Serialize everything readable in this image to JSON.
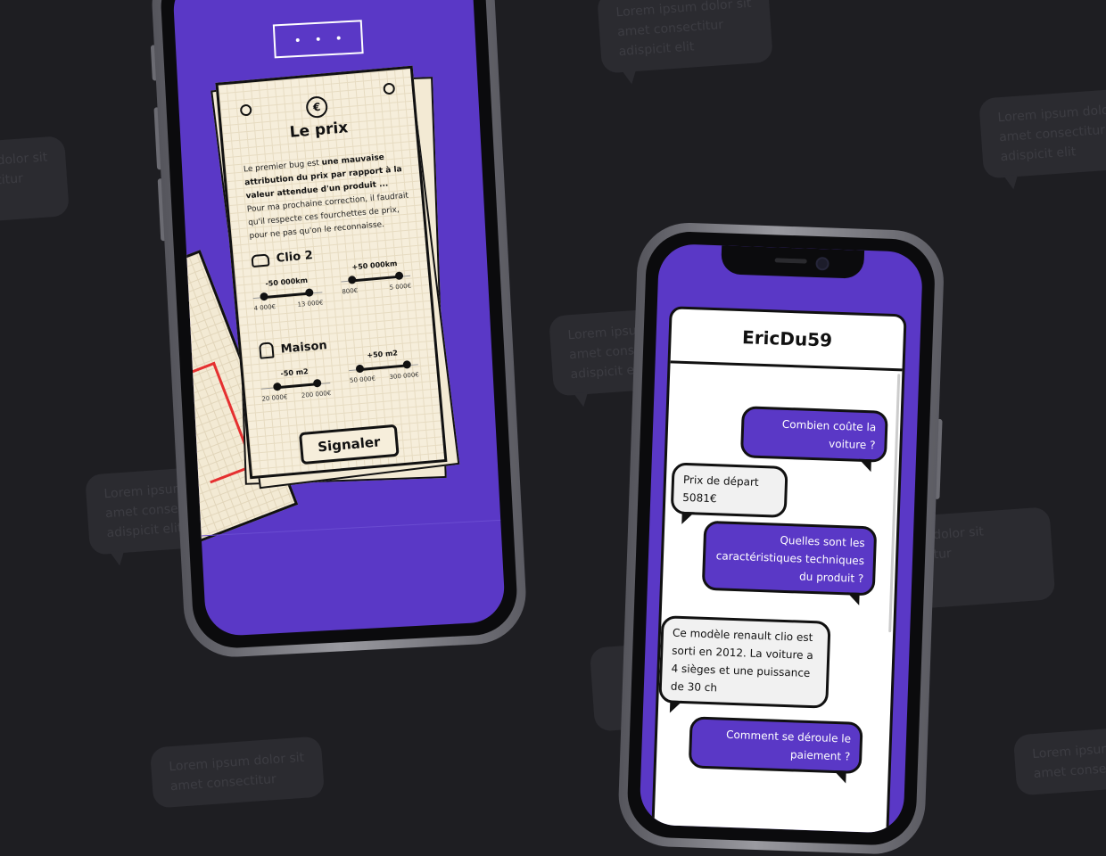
{
  "background_bubbles": [
    {
      "lines": [
        "Lorem ipsum dolor sit",
        "amet consectitur",
        "adispicit elit"
      ]
    },
    {
      "lines": [
        "Lorem ipsum dolor sit",
        "amet consectitur",
        "adispicit elit"
      ]
    },
    {
      "lines": [
        "m dolor sit",
        "ectitur",
        "it"
      ]
    },
    {
      "lines": [
        "Lorem ipsum",
        "amet consect",
        "adispicit elit"
      ]
    },
    {
      "lines": [
        "Lorem ipsum",
        "amet consect",
        "adispicit elit"
      ]
    },
    {
      "lines": [
        "m dolor sit",
        "ctitur"
      ]
    },
    {
      "lines": [
        "Lorem ipsum dolor sit",
        "amet consectitur"
      ]
    },
    {
      "lines": [
        "Lorem ipsum",
        "amet consec"
      ]
    }
  ],
  "phone1": {
    "card": {
      "title": "Le prix",
      "desc_part1": "Le premier bug est ",
      "desc_bold": "une mauvaise attribution du prix par rapport à la valeur attendue d'un produit ...",
      "desc_part2": " Pour ma prochaine correction, il faudrait qu'il respecte ces fourchettes de prix, pour ne pas qu'on le reconnaisse.",
      "sections": [
        {
          "name": "Clio 2",
          "icon": "car-icon",
          "ranges": [
            {
              "label": "-50 000km",
              "min": "4 000€",
              "max": "13 000€"
            },
            {
              "label": "+50 000km",
              "min": "800€",
              "max": "5 000€"
            }
          ]
        },
        {
          "name": "Maison",
          "icon": "house-icon",
          "ranges": [
            {
              "label": "-50 m2",
              "min": "20 000€",
              "max": "200 000€"
            },
            {
              "label": "+50 m2",
              "min": "50 000€",
              "max": "300 000€"
            }
          ]
        }
      ],
      "button": "Signaler"
    }
  },
  "phone2": {
    "chat_title": "EricDu59",
    "messages": [
      {
        "from": "user",
        "text": "Combien coûte la voiture ?"
      },
      {
        "from": "bot",
        "text": "Prix de départ 5081€"
      },
      {
        "from": "user",
        "text": "Quelles sont les caractéristiques techniques du produit ?"
      },
      {
        "from": "bot",
        "text": "Ce modèle renault clio est sorti en 2012. La voiture a 4 sièges et une puissance de 30 ch"
      },
      {
        "from": "user",
        "text": "Comment se déroule le paiement ?"
      }
    ]
  },
  "colors": {
    "background": "#1e1e22",
    "accent_purple": "#5a38c6",
    "paper": "#f6eedb",
    "red_plan": "#e53030"
  }
}
